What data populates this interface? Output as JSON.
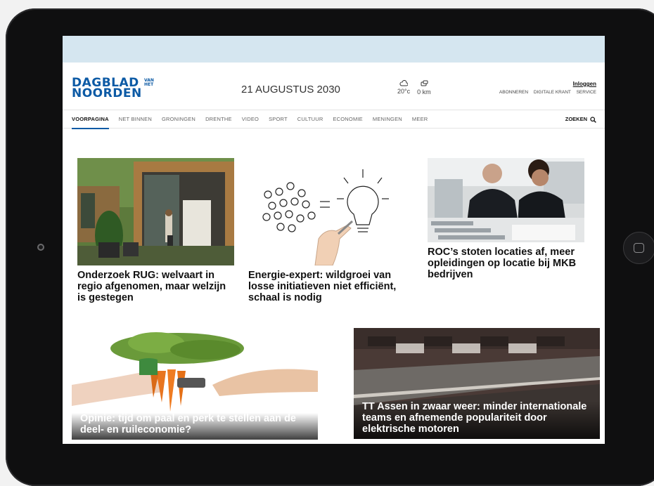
{
  "masthead": {
    "logo_line1": "DAGBLAD",
    "logo_line2": "NOORDEN",
    "logo_van": "VAN HET",
    "date": "21 AUGUSTUS 2030",
    "weather_temp": "20°c",
    "traffic": "0 km",
    "weather_icon": "cloud-icon",
    "traffic_icon": "traffic-icon"
  },
  "user": {
    "login": "Inloggen",
    "links": [
      "ABONNEREN",
      "DIGITALE KRANT",
      "SERVICE"
    ]
  },
  "nav": {
    "items": [
      "VOORPAGINA",
      "NET BINNEN",
      "GRONINGEN",
      "DRENTHE",
      "VIDEO",
      "SPORT",
      "CULTUUR",
      "ECONOMIE",
      "MENINGEN",
      "MEER"
    ],
    "active": "VOORPAGINA",
    "search": "ZOEKEN"
  },
  "articles": [
    {
      "title": "Onderzoek RUG: welvaart in regio afgenomen, maar welzijn is gestegen"
    },
    {
      "title": "Energie-expert: wildgroei van losse initiatieven niet efficiënt, schaal is nodig"
    },
    {
      "title": "ROC’s stoten locaties af, meer opleidingen op locatie bij MKB bedrijven"
    },
    {
      "title": "Opinie: tijd om paal en perk te stellen aan de deel- en ruileconomie?"
    },
    {
      "title": "TT Assen in zwaar weer: minder internationale teams en afnemende populariteit door elektrische motoren"
    }
  ],
  "colors": {
    "brand": "#0c5aa5",
    "adbar": "#d5e6f0"
  }
}
